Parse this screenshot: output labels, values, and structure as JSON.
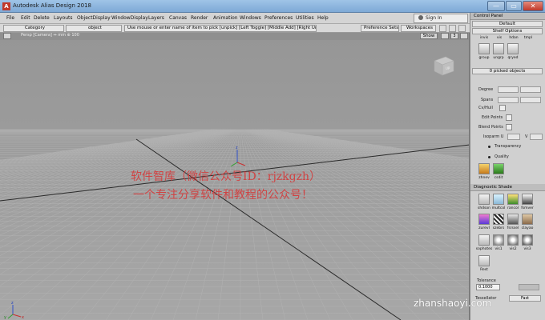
{
  "window": {
    "title": "Autodesk Alias Design 2018",
    "logo": "A",
    "minimize_glyph": "—",
    "maximize_glyph": "▭",
    "close_glyph": "✕"
  },
  "menu": {
    "items": [
      "File",
      "Edit",
      "Delete",
      "Layouts",
      "ObjectDisplay",
      "WindowDisplay",
      "Layers",
      "Canvas",
      "Render",
      "Animation",
      "Windows",
      "Preferences",
      "Utilities",
      "Help"
    ],
    "sign_in": "Sign In"
  },
  "statusbar": {
    "category": "Category",
    "object": "object",
    "prompt": "Use mouse or enter name of item to pick [unpick] [Left Toggle] [Middle Add] [Right Unpick]",
    "preference_sets": "Preference Sets",
    "workspaces": "Workspaces"
  },
  "viewport": {
    "label": "Persp [Camera]  ↔ mm  ⊕ 100",
    "show_button": "Show",
    "badge": "3",
    "viewcube_label": "UP",
    "axis_x": "x",
    "axis_y": "y",
    "axis_z": "z"
  },
  "watermark": {
    "line1": "软件智库（微信公众号ID：rjzkgzh）",
    "line2": "一个专注分享软件和教程的公众号！",
    "site": "zhanshaoyi.com"
  },
  "control_panel": {
    "title": "Control Panel",
    "default_dropdown": "Default",
    "shelf_options": "Shelf Options",
    "shelf_labels": [
      "invis",
      "vis",
      "hdan",
      "tmpl"
    ],
    "shelf_labels2": [
      "group",
      "ungrp",
      "qryed"
    ],
    "picked_objects": "0 picked objects",
    "degree_label": "Degree",
    "spans_label": "Spans",
    "cvhull_label": "Cv/Hull",
    "edit_points_label": "Edit Points",
    "blend_points_label": "Blend Points",
    "isoparm_label": "Isoparm U",
    "isoparm_v": "V",
    "transparency_label": "Transparency",
    "quality_label": "Quality",
    "tool_labels": [
      "zhnev",
      "csdit"
    ],
    "diagnostic_title": "Diagnostic Shade",
    "diag_labels_row1": [
      "shdson",
      "multcol",
      "rancol",
      "fsmver"
    ],
    "diag_labels_row2": [
      "zurevl",
      "szebrs",
      "fsrssel",
      "clayao"
    ],
    "diag_labels_row3": [
      "sophotes",
      "vis1",
      "vis2",
      "vis3"
    ],
    "diag_labels_row4": [
      "Rest"
    ],
    "tolerance_label": "Tolerance",
    "tolerance_value": "0.1000",
    "tessellator_label": "Tessellator",
    "tessellator_value": "Fast"
  },
  "colors": {
    "watermark": "#d53a3a",
    "title_gradient_top": "#9fc4e7",
    "close_red": "#c0392b"
  }
}
